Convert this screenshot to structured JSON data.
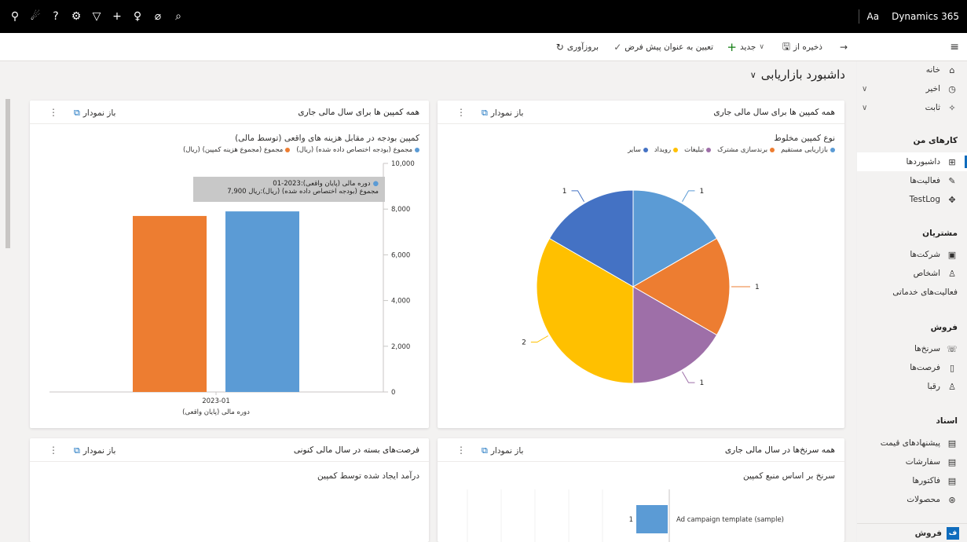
{
  "topbar": {
    "icons": [
      "person-icon",
      "lightbulb-feedback-icon",
      "help-icon",
      "settings-icon",
      "filter-icon",
      "add-icon",
      "idea-icon",
      "target-icon",
      "search-icon"
    ],
    "icon_glyphs": [
      "⚲",
      "☄",
      "?",
      "⚙",
      "▽",
      "+",
      "♀",
      "⌀",
      "⌕"
    ],
    "font_label": "Aa",
    "app_name": "Dynamics 365"
  },
  "commandbar": {
    "back_glyph": "→",
    "save_as_label": "ذخیره از",
    "new_label": "جدید",
    "set_default_label": "تعیین به عنوان پیش فرض",
    "refresh_label": "بروزآوری"
  },
  "dashboard": {
    "title": "داشبورد بازاریابی"
  },
  "sidebar": {
    "menu_glyph": "≡",
    "items": [
      {
        "label": "خانه",
        "icon": "⌂"
      },
      {
        "label": "اخیر",
        "icon": "◷"
      },
      {
        "label": "ثابت",
        "icon": "✧"
      }
    ],
    "sections": [
      {
        "title": "کارهای من",
        "items": [
          {
            "label": "داشبوردها",
            "icon": "⊞",
            "active": true
          },
          {
            "label": "فعالیت‌ها",
            "icon": "✎"
          },
          {
            "label": "TestLog",
            "icon": "✥"
          }
        ]
      },
      {
        "title": "مشتریان",
        "items": [
          {
            "label": "شرکت‌ها",
            "icon": "▣"
          },
          {
            "label": "اشخاص",
            "icon": "♙"
          },
          {
            "label": "فعالیت‌های خدماتی",
            "icon": ""
          }
        ]
      },
      {
        "title": "فروش",
        "items": [
          {
            "label": "سرنخ‌ها",
            "icon": "☏"
          },
          {
            "label": "فرصت‌ها",
            "icon": "▯"
          },
          {
            "label": "رقبا",
            "icon": "♙"
          }
        ]
      },
      {
        "title": "اسناد",
        "items": [
          {
            "label": "پیشنهادهای قیمت",
            "icon": "▤"
          },
          {
            "label": "سفارشات",
            "icon": "▤"
          },
          {
            "label": "فاکتورها",
            "icon": "▤"
          },
          {
            "label": "محصولات",
            "icon": "⊛"
          }
        ]
      }
    ],
    "footer_badge": "ف",
    "footer_label": "فروش"
  },
  "cards": [
    {
      "title": "همه کمپین ها برای سال مالی جاری",
      "open_label": "باز نمودار",
      "subtitle": "نوع کمپین مخلوط",
      "legend": [
        {
          "label": "بازاریابی مستقیم",
          "color": "#5b9bd5"
        },
        {
          "label": "برندسازی مشترک",
          "color": "#ed7d31"
        },
        {
          "label": "تبلیغات",
          "color": "#9e6fa8"
        },
        {
          "label": "رویداد",
          "color": "#ffc000"
        },
        {
          "label": "سایر",
          "color": "#4472c4"
        }
      ]
    },
    {
      "title": "همه کمپین ها برای سال مالی جاری",
      "open_label": "باز نمودار",
      "subtitle": "کمپین بودجه در مقابل هزینه های واقعی (توسط مالی)",
      "legend": [
        {
          "label": "مجموع (بودجه اختصاص داده شده) (ریال)",
          "color": "#5b9bd5"
        },
        {
          "label": "مجموع (مجموع هزینه کمپین) (ریال)",
          "color": "#ed7d31"
        }
      ]
    },
    {
      "title": "همه سرنخ‌ها در سال مالی جاری",
      "open_label": "باز نمودار",
      "subtitle": "سرنخ بر اساس منبع کمپین"
    },
    {
      "title": "فرصت‌های بسته در سال مالی کنونی",
      "open_label": "باز نمودار",
      "subtitle": "درآمد ایجاد شده توسط کمپین"
    }
  ],
  "chart_data": [
    {
      "type": "pie",
      "categories": [
        "بازاریابی مستقیم",
        "برندسازی مشترک",
        "تبلیغات",
        "رویداد",
        "سایر"
      ],
      "values": [
        1,
        1,
        1,
        2,
        1
      ],
      "colors": [
        "#5b9bd5",
        "#ed7d31",
        "#9e6fa8",
        "#ffc000",
        "#4472c4"
      ],
      "title": "نوع کمپین مخلوط",
      "legend": "top"
    },
    {
      "type": "bar",
      "categories": [
        "2023-01"
      ],
      "series": [
        {
          "name": "مجموع (مجموع هزینه کمپین) (ریال)",
          "values": [
            7700
          ],
          "color": "#ed7d31"
        },
        {
          "name": "مجموع (بودجه اختصاص داده شده) (ریال)",
          "values": [
            7900
          ],
          "color": "#5b9bd5"
        }
      ],
      "title": "کمپین بودجه در مقابل هزینه های واقعی (توسط مالی)",
      "xlabel": "دوره مالی (پایان واقعی)",
      "yticks": [
        "0",
        "2,000",
        "4,000",
        "6,000",
        "8,000",
        "10,000"
      ],
      "ylim": [
        0,
        10000
      ],
      "tooltip": {
        "line1": "دوره مالی (پایان واقعی):2023-01",
        "line2": "مجموع (بودجه اختصاص داده شده) (ریال):ریال 7,900"
      }
    },
    {
      "type": "bar",
      "orientation": "horizontal",
      "categories": [
        "Ad campaign template (sample)"
      ],
      "values": [
        1
      ],
      "color": "#5b9bd5",
      "title": "سرنخ بر اساس منبع کمپین"
    }
  ]
}
